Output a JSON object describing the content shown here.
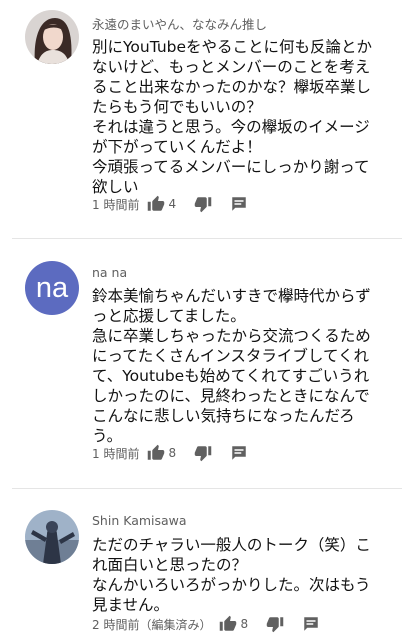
{
  "comments": [
    {
      "author": "永遠のまいやん、ななみん推し",
      "lines": [
        "別にYouTubeをやることに何も反論とか",
        "ないけど、もっとメンバーのことを考え",
        "ること出来なかったのかな？欅坂卒業し",
        "たらもう何でもいいの？",
        "それは違うと思う。今の欅坂のイメージ",
        "が下がっていくんだよ！",
        "今頑張ってるメンバーにしっかり謝って",
        "欲しい"
      ],
      "time": "1 時間前",
      "likes": "4",
      "avatar_type": "photo"
    },
    {
      "author": "na na",
      "avatar_text": "na",
      "avatar_color": "#5c6bc0",
      "lines": [
        "鈴本美愉ちゃんだいすきで欅時代からず",
        "っと応援してました。",
        "急に卒業しちゃったから交流つくるため",
        "にってたくさんインスタライブしてくれ",
        "て、Youtubeも始めてくれてすごいうれ",
        "しかったのに、見終わったときになんで",
        "こんなに悲しい気持ちになったんだろ",
        "う。"
      ],
      "time": "1 時間前",
      "likes": "8",
      "avatar_type": "letters"
    },
    {
      "author": "Shin Kamisawa",
      "lines": [
        "ただのチャラい一般人のトーク（笑）こ",
        "れ面白いと思ったの？",
        "なんかいろいろがっかりした。次はもう",
        "見ません。"
      ],
      "time": "2 時間前（編集済み）",
      "likes": "8",
      "avatar_type": "photo"
    }
  ],
  "icons": {
    "like": "thumbs-up-icon",
    "dislike": "thumbs-down-icon",
    "reply": "reply-icon"
  }
}
